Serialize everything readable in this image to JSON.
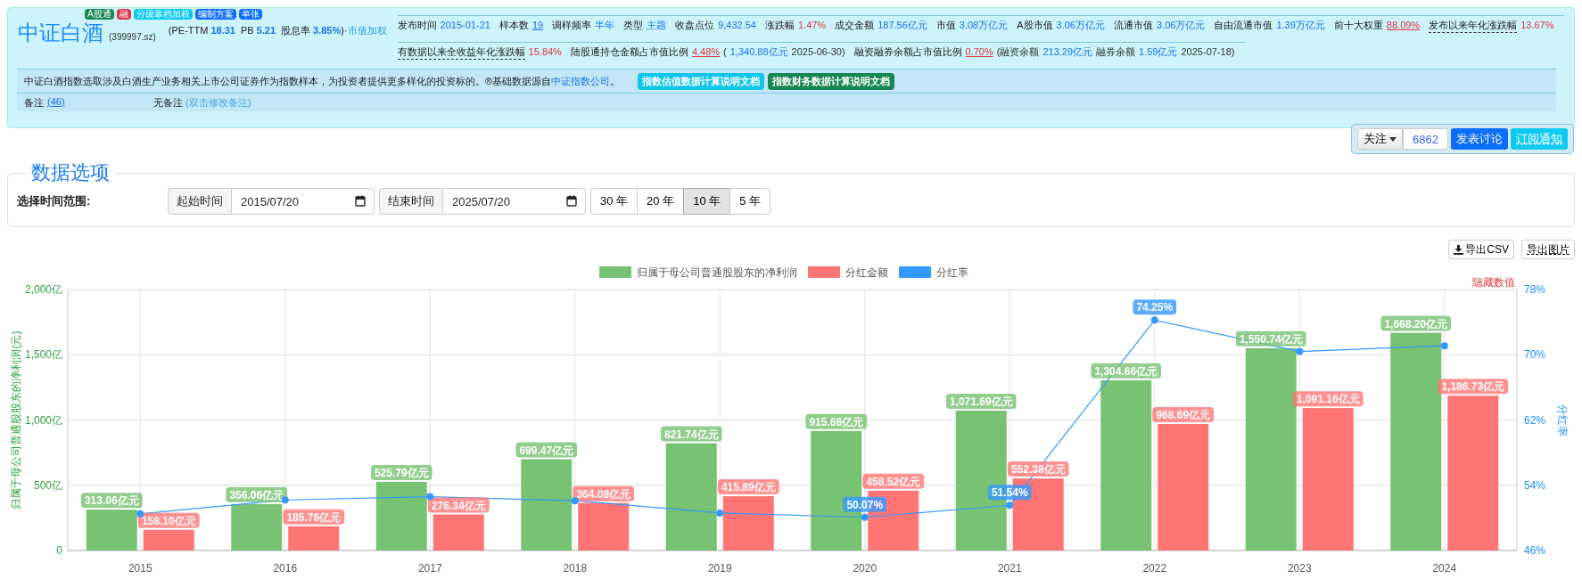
{
  "header": {
    "badges": [
      {
        "text": "A股通",
        "color": "#198754"
      },
      {
        "text": "融",
        "color": "#dc3545"
      },
      {
        "text": "分级靠档加权",
        "color": "#0dcaf0"
      },
      {
        "text": "编制方案",
        "color": "#0d6efd"
      },
      {
        "text": "单张",
        "color": "#0d6efd"
      }
    ],
    "title": "中证白酒",
    "code": "(399997.sz)",
    "valuation": [
      {
        "label": "(PE-TTM",
        "value": "18.31"
      },
      {
        "label": "PB",
        "value": "5.21"
      },
      {
        "label": "股息率",
        "value": "3.85%",
        "after": ")·"
      }
    ],
    "weighting": "市值加权",
    "info_rows": [
      [
        {
          "label": "发布时间",
          "parts": [
            {
              "text": "2015-01-21",
              "kind": "figure"
            }
          ]
        },
        {
          "label": "样本数",
          "parts": [
            {
              "text": "19",
              "kind": "figure",
              "link": true
            }
          ]
        },
        {
          "label": "调样频率",
          "parts": [
            {
              "text": "半年",
              "kind": "figure"
            }
          ]
        },
        {
          "label": "类型",
          "parts": [
            {
              "text": "主题",
              "kind": "figure"
            }
          ]
        },
        {
          "label": "收盘点位",
          "parts": [
            {
              "text": "9,432.54",
              "kind": "figure"
            }
          ]
        },
        {
          "label": "涨跌幅",
          "parts": [
            {
              "text": "1.47%",
              "kind": "change"
            }
          ]
        },
        {
          "label": "成交金额",
          "parts": [
            {
              "text": "187.56亿元",
              "kind": "figure"
            }
          ]
        },
        {
          "label": "市值",
          "parts": [
            {
              "text": "3.08万亿元",
              "kind": "figure"
            }
          ]
        },
        {
          "label": "A股市值",
          "parts": [
            {
              "text": "3.06万亿元",
              "kind": "figure"
            }
          ]
        },
        {
          "label": "流通市值",
          "parts": [
            {
              "text": "3.06万亿元",
              "kind": "figure"
            }
          ]
        },
        {
          "label": "自由流通市值",
          "parts": [
            {
              "text": "1.39万亿元",
              "kind": "figure"
            }
          ]
        },
        {
          "label": "前十大权重",
          "parts": [
            {
              "text": "88.09%",
              "kind": "change",
              "link": true
            }
          ]
        },
        {
          "label": "发布以来年化涨跌幅",
          "dashed": true,
          "parts": [
            {
              "text": "13.67%",
              "kind": "change"
            }
          ]
        }
      ],
      [
        {
          "label": "有数据以来全收益年化涨跌幅",
          "dashed": true,
          "parts": [
            {
              "text": "15.84%",
              "kind": "change"
            }
          ]
        },
        {
          "label": "陆股通持仓金额占市值比例",
          "parts": [
            {
              "text": "4.48%",
              "kind": "change",
              "link": true
            },
            {
              "text": "(",
              "kind": "note"
            },
            {
              "text": "1,340.88亿元",
              "kind": "figure"
            },
            {
              "text": "2025-06-30)",
              "kind": "note"
            }
          ]
        },
        {
          "label": "融资融券余额占市值比例",
          "parts": [
            {
              "text": "0.70%",
              "kind": "change",
              "link": true
            },
            {
              "text": "(融资余额",
              "kind": "note"
            },
            {
              "text": "213.29亿元",
              "kind": "figure"
            },
            {
              "text": "融券余额",
              "kind": "note"
            },
            {
              "text": "1.59亿元",
              "kind": "figure"
            },
            {
              "text": "2025-07-18)",
              "kind": "note"
            }
          ]
        }
      ]
    ],
    "description": {
      "text": "中证白酒指数选取涉及白酒生产业务相关上市公司证券作为指数样本，为投资者提供更多样化的投资标的。®基础数据源自",
      "link": "中证指数公司",
      "end": "。"
    },
    "doc_buttons": [
      {
        "label": "指数估值数据计算说明文档",
        "kind": "info"
      },
      {
        "label": "指数财务数据计算说明文档",
        "kind": "success"
      }
    ],
    "remarks": {
      "label": "备注",
      "count": "(46)",
      "text": "无备注",
      "hint": "(双击修改备注)"
    }
  },
  "actions": {
    "follow": "关注",
    "followers": "6862",
    "discuss": "发表讨论",
    "subscribe": "订阅通知"
  },
  "options": {
    "title": "数据选项",
    "range_label": "选择时间范围:",
    "start": {
      "label": "起始时间",
      "value": "2015/07/20"
    },
    "end": {
      "label": "结束时间",
      "value": "2025/07/20"
    },
    "ranges": [
      {
        "label": "30 年",
        "selected": false
      },
      {
        "label": "20 年",
        "selected": false
      },
      {
        "label": "10 年",
        "selected": true
      },
      {
        "label": "5 年",
        "selected": false
      }
    ]
  },
  "chart_toolbar": {
    "export_csv": "导出CSV",
    "export_image": "导出图片"
  },
  "chart": {
    "hide_values": "隐藏数值",
    "chart_data": {
      "type": "bar",
      "categories": [
        "2015",
        "2016",
        "2017",
        "2018",
        "2019",
        "2020",
        "2021",
        "2022",
        "2023",
        "2024"
      ],
      "series": [
        {
          "name": "归属于母公司普通股股东的净利润",
          "color": "#78c273",
          "values": [
            313.06,
            356.06,
            525.79,
            699.47,
            821.74,
            915.68,
            1071.69,
            1304.66,
            1550.74,
            1668.2
          ]
        },
        {
          "name": "分红金额",
          "color": "#ff7575",
          "values": [
            158.1,
            185.76,
            276.34,
            364.08,
            415.89,
            458.52,
            552.38,
            968.69,
            1091.16,
            1186.73
          ]
        },
        {
          "name": "分红率",
          "color": "#3399ff",
          "type": "line",
          "axis": "y2",
          "marker": "circle",
          "values": [
            50.5,
            52.2,
            52.6,
            52.1,
            50.6,
            50.07,
            51.54,
            74.25,
            70.4,
            71.1
          ]
        }
      ],
      "ylabel": "归属于母公司普通股股东的净利润(元)",
      "ylim": [
        0,
        2000
      ],
      "yticks": [
        {
          "value": 0,
          "label": "0"
        },
        {
          "value": 500,
          "label": "500亿"
        },
        {
          "value": 1000,
          "label": "1,000亿"
        },
        {
          "value": 1500,
          "label": "1,500亿"
        },
        {
          "value": 2000,
          "label": "2,000亿"
        }
      ],
      "y2label": "分红率",
      "y2lim": [
        46,
        78
      ],
      "y2ticks": [
        {
          "value": 46,
          "label": "46%"
        },
        {
          "value": 54,
          "label": "54%"
        },
        {
          "value": 62,
          "label": "62%"
        },
        {
          "value": 70,
          "label": "70%"
        },
        {
          "value": 78,
          "label": "78%"
        }
      ],
      "grid": true,
      "legend": true,
      "annotations": [
        {
          "x": "2015",
          "y": 313.06,
          "text": "313.06亿元"
        },
        {
          "x": "2016",
          "y": 356.06,
          "text": "356.06亿元"
        },
        {
          "x": "2017",
          "y": 525.79,
          "text": "525.79亿元"
        },
        {
          "x": "2018",
          "y": 699.47,
          "text": "699.47亿元"
        },
        {
          "x": "2019",
          "y": 821.74,
          "text": "821.74亿元"
        },
        {
          "x": "2020",
          "y": 915.68,
          "text": "915.68亿元"
        },
        {
          "x": "2021",
          "y": 1071.69,
          "text": "1,071.69亿元"
        },
        {
          "x": "2022",
          "y": 1304.66,
          "text": "1,304.66亿元"
        },
        {
          "x": "2023",
          "y": 1550.74,
          "text": "1,550.74亿元"
        },
        {
          "x": "2024",
          "y": 1668.2,
          "text": "1,668.20亿元"
        },
        {
          "x": "2015",
          "y": 158.1,
          "text": "158.10亿元"
        },
        {
          "x": "2016",
          "y": 185.76,
          "text": "185.76亿元"
        },
        {
          "x": "2017",
          "y": 276.34,
          "text": "276.34亿元"
        },
        {
          "x": "2018",
          "y": 364.08,
          "text": "364.08亿元"
        },
        {
          "x": "2019",
          "y": 415.89,
          "text": "415.89亿元"
        },
        {
          "x": "2020",
          "y": 458.52,
          "text": "458.52亿元"
        },
        {
          "x": "2021",
          "y": 552.38,
          "text": "552.38亿元"
        },
        {
          "x": "2022",
          "y": 968.69,
          "text": "968.69亿元"
        },
        {
          "x": "2023",
          "y": 1091.16,
          "text": "1,091.16亿元"
        },
        {
          "x": "2024",
          "y": 1186.73,
          "text": "1,186.73亿元"
        },
        "50.07%",
        "51.54%",
        "74.25%"
      ]
    }
  }
}
